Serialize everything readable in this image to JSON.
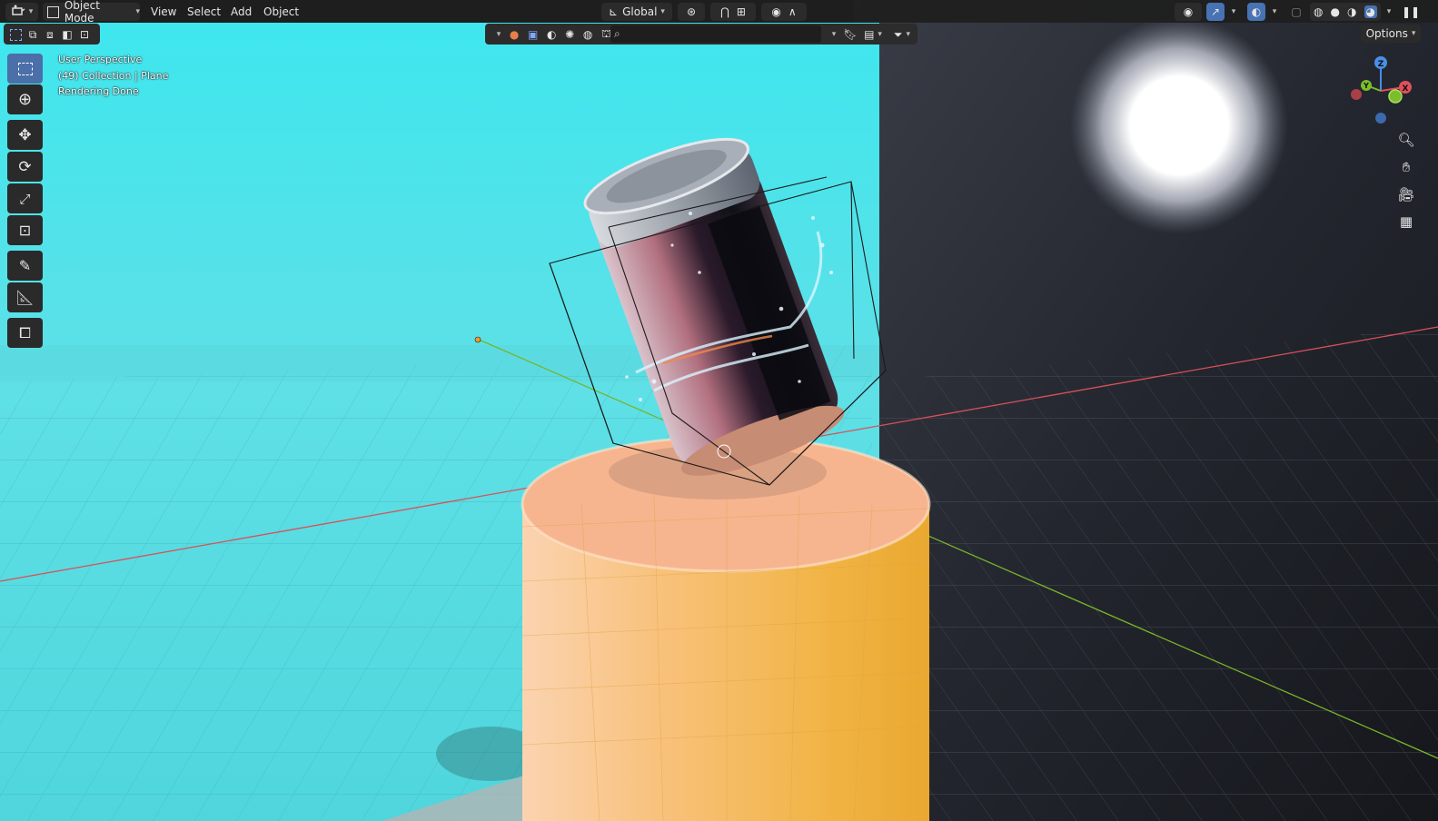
{
  "header": {
    "mode_label": "Object Mode",
    "menus": [
      "View",
      "Select",
      "Add",
      "Object"
    ],
    "transform_orientation": "Global",
    "options_label": "Options"
  },
  "overlay": {
    "line1": "User Perspective",
    "line2": "(49) Collection | Plane",
    "line3": "Rendering Done"
  },
  "gizmo": {
    "x_label": "X",
    "y_label": "Y",
    "z_label": "Z"
  },
  "icons": {
    "editor_type": "editor-type-icon",
    "mode": "object-mode-icon",
    "tools": [
      "select-box-icon",
      "cursor-icon",
      "move-icon",
      "rotate-icon",
      "scale-icon",
      "transform-icon",
      "annotate-icon",
      "measure-icon",
      "add-cube-icon"
    ],
    "nav": [
      "zoom-icon",
      "hand-pan-icon",
      "camera-icon",
      "grid-icon"
    ]
  },
  "colors": {
    "accent": "#4772b3",
    "background_cyan": "#4fe3ea",
    "pedestal": "#f3b84c",
    "x_axis": "#e0505b",
    "y_axis": "#7bbd2b",
    "z_axis": "#4a8ee8"
  }
}
